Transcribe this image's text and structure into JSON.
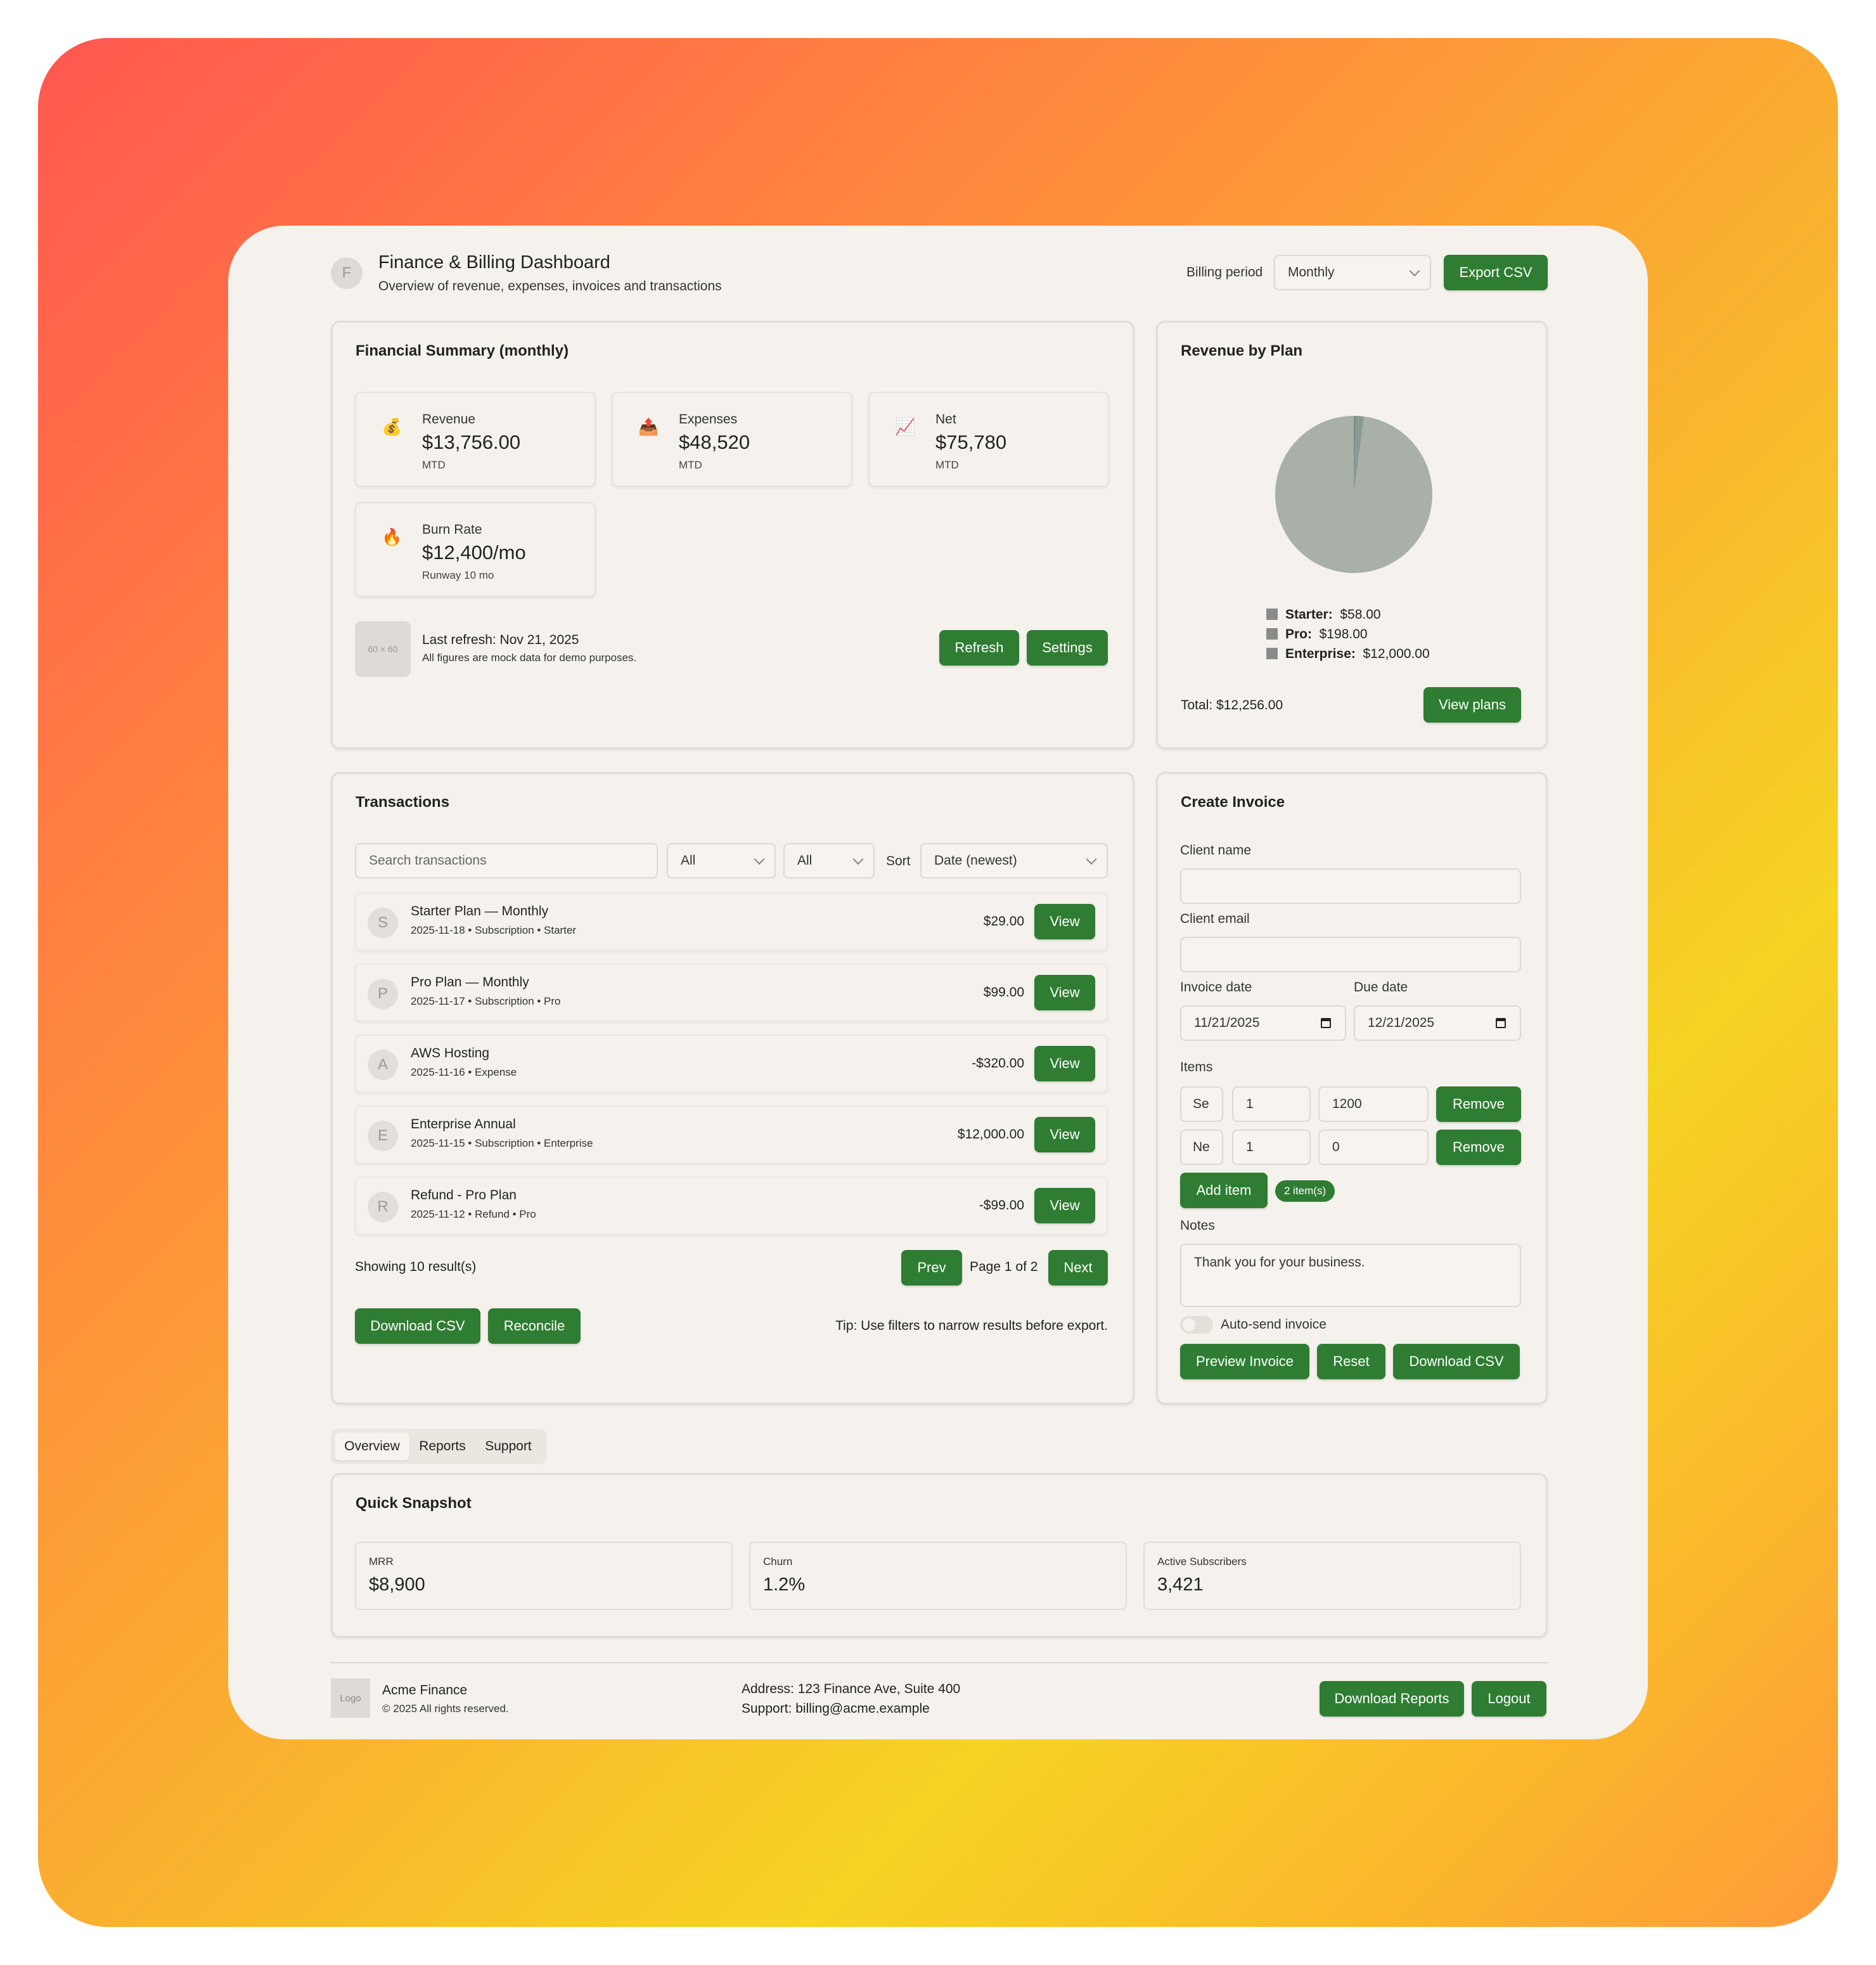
{
  "header": {
    "avatar_letter": "F",
    "title": "Finance & Billing Dashboard",
    "subtitle": "Overview of revenue, expenses, invoices and transactions",
    "billing_period_label": "Billing period",
    "billing_period_value": "Monthly",
    "export_label": "Export CSV"
  },
  "summary": {
    "title": "Financial Summary (monthly)",
    "stats": [
      {
        "icon": "money-bag-icon",
        "glyph": "💰",
        "label": "Revenue",
        "value": "$13,756.00",
        "sub": "MTD"
      },
      {
        "icon": "outbox-icon",
        "glyph": "📤",
        "label": "Expenses",
        "value": "$48,520",
        "sub": "MTD"
      },
      {
        "icon": "chart-up-icon",
        "glyph": "📈",
        "label": "Net",
        "value": "$75,780",
        "sub": "MTD"
      },
      {
        "icon": "fire-icon",
        "glyph": "🔥",
        "label": "Burn Rate",
        "value": "$12,400/mo",
        "sub": "Runway 10 mo"
      }
    ],
    "placeholder_label": "60 × 60",
    "last_refresh": "Last refresh: Nov 21, 2025",
    "note": "All figures are mock data for demo purposes.",
    "refresh_label": "Refresh",
    "settings_label": "Settings"
  },
  "revenue": {
    "title": "Revenue by Plan",
    "legend": [
      {
        "name": "Starter:",
        "value": "$58.00"
      },
      {
        "name": "Pro:",
        "value": "$198.00"
      },
      {
        "name": "Enterprise:",
        "value": "$12,000.00"
      }
    ],
    "total": "Total: $12,256.00",
    "view_plans_label": "View plans"
  },
  "chart_data": {
    "type": "pie",
    "categories": [
      "Starter",
      "Pro",
      "Enterprise"
    ],
    "values": [
      58,
      198,
      12000
    ],
    "colors": [
      "#7f8c8d",
      "#8a9a94",
      "#a9b0a8"
    ],
    "title": "Revenue by Plan"
  },
  "transactions": {
    "title": "Transactions",
    "search_placeholder": "Search transactions",
    "filter1": "All",
    "filter2": "All",
    "sort_label": "Sort",
    "sort_value": "Date (newest)",
    "rows": [
      {
        "letter": "S",
        "title": "Starter Plan — Monthly",
        "meta": "2025-11-18 • Subscription • Starter",
        "amount": "$29.00",
        "action": "View"
      },
      {
        "letter": "P",
        "title": "Pro Plan — Monthly",
        "meta": "2025-11-17 • Subscription • Pro",
        "amount": "$99.00",
        "action": "View"
      },
      {
        "letter": "A",
        "title": "AWS Hosting",
        "meta": "2025-11-16 • Expense",
        "amount": "-$320.00",
        "action": "View"
      },
      {
        "letter": "E",
        "title": "Enterprise Annual",
        "meta": "2025-11-15 • Subscription • Enterprise",
        "amount": "$12,000.00",
        "action": "View"
      },
      {
        "letter": "R",
        "title": "Refund - Pro Plan",
        "meta": "2025-11-12 • Refund • Pro",
        "amount": "-$99.00",
        "action": "View"
      }
    ],
    "showing": "Showing 10 result(s)",
    "prev_label": "Prev",
    "page_info": "Page 1 of 2",
    "next_label": "Next",
    "download_label": "Download CSV",
    "reconcile_label": "Reconcile",
    "tip": "Tip: Use filters to narrow results before export."
  },
  "invoice": {
    "title": "Create Invoice",
    "client_name_label": "Client name",
    "client_email_label": "Client email",
    "invoice_date_label": "Invoice date",
    "due_date_label": "Due date",
    "invoice_date_value": "11/21/2025",
    "due_date_value": "12/21/2025",
    "items_label": "Items",
    "items": [
      {
        "desc": "Se",
        "qty": "1",
        "price": "1200"
      },
      {
        "desc": "Ne",
        "qty": "1",
        "price": "0"
      }
    ],
    "remove_label": "Remove",
    "add_item_label": "Add item",
    "item_count": "2 item(s)",
    "notes_label": "Notes",
    "notes_value": "Thank you for your business.",
    "auto_send_label": "Auto-send invoice",
    "auto_send_on": false,
    "preview_label": "Preview Invoice",
    "reset_label": "Reset",
    "download_label": "Download CSV"
  },
  "tabs": [
    "Overview",
    "Reports",
    "Support"
  ],
  "snapshot": {
    "title": "Quick Snapshot",
    "cards": [
      {
        "label": "MRR",
        "value": "$8,900"
      },
      {
        "label": "Churn",
        "value": "1.2%"
      },
      {
        "label": "Active Subscribers",
        "value": "3,421"
      }
    ]
  },
  "footer": {
    "logo_label": "Logo",
    "company": "Acme Finance",
    "copyright": "© 2025 All rights reserved.",
    "address": "Address: 123 Finance Ave, Suite 400",
    "support": "Support: billing@acme.example",
    "download_reports_label": "Download Reports",
    "logout_label": "Logout"
  },
  "colors": {
    "accent": "#2e7d32",
    "card_bg": "#f5f2ed"
  }
}
